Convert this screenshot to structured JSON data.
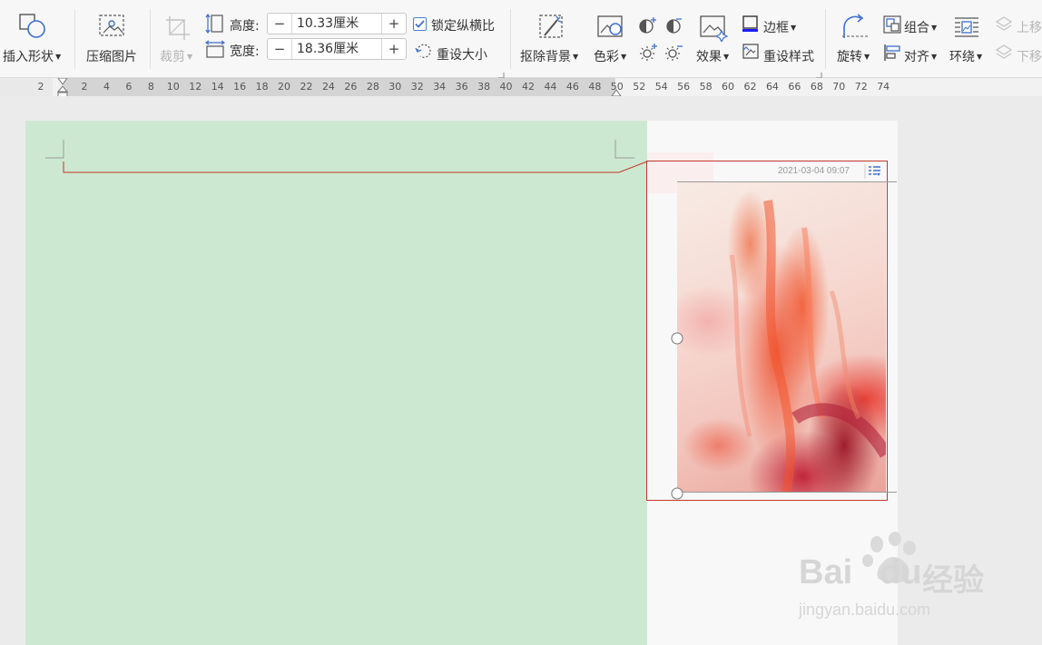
{
  "toolbar": {
    "insert_shape": "插入形状",
    "compress_picture": "压缩图片",
    "crop": "裁剪",
    "height_label": "高度:",
    "height_value": "10.33厘米",
    "width_label": "宽度:",
    "width_value": "18.36厘米",
    "minus": "−",
    "plus": "+",
    "lock_ratio": "锁定纵横比",
    "reset_size": "重设大小",
    "remove_background": "抠除背景",
    "color": "色彩",
    "border": "边框",
    "effects": "效果",
    "reset_style": "重设样式",
    "rotate": "旋转",
    "group": "组合",
    "align": "对齐",
    "wrap": "环绕",
    "bring_forward": "上移",
    "send_backward": "下移"
  },
  "ruler": {
    "ticks": [
      "2",
      "2",
      "4",
      "6",
      "8",
      "10",
      "12",
      "14",
      "16",
      "18",
      "20",
      "22",
      "24",
      "26",
      "28",
      "30",
      "32",
      "34",
      "36",
      "38",
      "40",
      "42",
      "44",
      "46",
      "48",
      "50",
      "52",
      "54",
      "56",
      "58",
      "60",
      "62",
      "64",
      "66",
      "68",
      "70",
      "72",
      "74"
    ]
  },
  "comment": {
    "timestamp": "2021-03-04 09:07"
  },
  "watermark": {
    "brand": "Bai",
    "brand2": "du",
    "cn": "经验",
    "url": "jingyan.baidu.com"
  },
  "colors": {
    "page_green": "#cde8d1",
    "selection_red": "#c0392b",
    "accent_blue": "#3d6fd1"
  }
}
